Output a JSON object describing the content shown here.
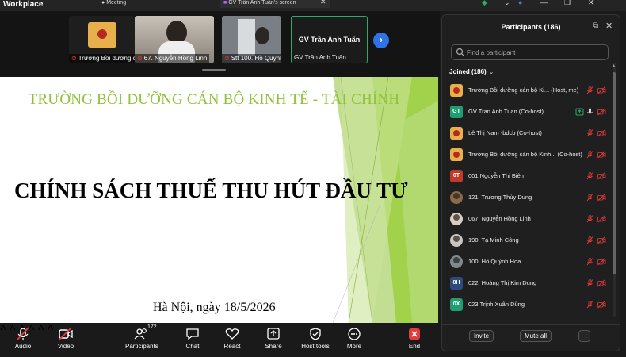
{
  "window": {
    "app_title": "Workplace",
    "tabs": [
      {
        "label": "Meeting"
      },
      {
        "label": "GV Trần Anh Tuấn's screen"
      }
    ]
  },
  "video_strip": {
    "thumbnails": [
      {
        "label": "Trường Bồi dưỡng c"
      },
      {
        "label": "67. Nguyễn Hồng Linh"
      },
      {
        "label": "Stt 100. Hồ Quỳnh"
      },
      {
        "name": "GV Trần Anh Tuấn",
        "label": "GV Trần Anh Tuấn"
      }
    ],
    "next_icon": "chevron-right-icon"
  },
  "slide": {
    "school": "TRƯỜNG BỒI DƯỠNG CÁN BỘ KINH TẾ - TÀI CHÍNH",
    "title": "CHÍNH SÁCH THUẾ THU HÚT ĐẦU TƯ",
    "place_date": "Hà Nội, ngày 18/5/2026",
    "accent_color": "#8fc23a"
  },
  "toolbar": {
    "audio": "Audio",
    "video": "Video",
    "participants": "Participants",
    "participants_count": "172",
    "chat": "Chat",
    "react": "React",
    "share": "Share",
    "host_tools": "Host tools",
    "more": "More",
    "end": "End"
  },
  "panel": {
    "title": "Participants (186)",
    "search_placeholder": "Find a participant",
    "joined": "Joined (186)",
    "invite": "Invite",
    "mute_all": "Mute all",
    "more_icon": "ellipsis-icon",
    "participants": [
      {
        "name": "Trường Bồi dưỡng cán bộ Ki... (Host, me)",
        "avatar": "logo",
        "initials": "",
        "color": "#e8b04a",
        "sharing": false
      },
      {
        "name": "GV Tran Anh Tuan (Co-host)",
        "avatar": "initials",
        "initials": "GT",
        "color": "#1f9e72",
        "sharing": true
      },
      {
        "name": "Lê Thị Nam -bdcb (Co-host)",
        "avatar": "logo",
        "initials": "",
        "color": "#e8b04a",
        "sharing": false
      },
      {
        "name": "Trường Bồi dưỡng cán bộ Kinh... (Co-host)",
        "avatar": "logo",
        "initials": "",
        "color": "#e8b04a",
        "sharing": false
      },
      {
        "name": "001.Nguyễn Thị Biên",
        "avatar": "initials",
        "initials": "0T",
        "color": "#c0392b",
        "sharing": false
      },
      {
        "name": "121. Trương Thùy Dung",
        "avatar": "photo",
        "initials": "",
        "color": "#8a6a4a",
        "sharing": false
      },
      {
        "name": "067. Nguyễn Hồng Linh",
        "avatar": "photo",
        "initials": "",
        "color": "#d9cfc4",
        "sharing": false
      },
      {
        "name": "190. Tạ Minh Công",
        "avatar": "photo",
        "initials": "",
        "color": "#c9c6c2",
        "sharing": false
      },
      {
        "name": "100. Hồ Quỳnh Hoa",
        "avatar": "photo",
        "initials": "",
        "color": "#7f8a8f",
        "sharing": false
      },
      {
        "name": "022. Hoàng  Thị Kim Dung",
        "avatar": "initials",
        "initials": "0H",
        "color": "#2c4a7a",
        "sharing": false
      },
      {
        "name": "023.Trịnh Xuân Dũng",
        "avatar": "initials",
        "initials": "0X",
        "color": "#1f9e72",
        "sharing": false
      }
    ]
  }
}
